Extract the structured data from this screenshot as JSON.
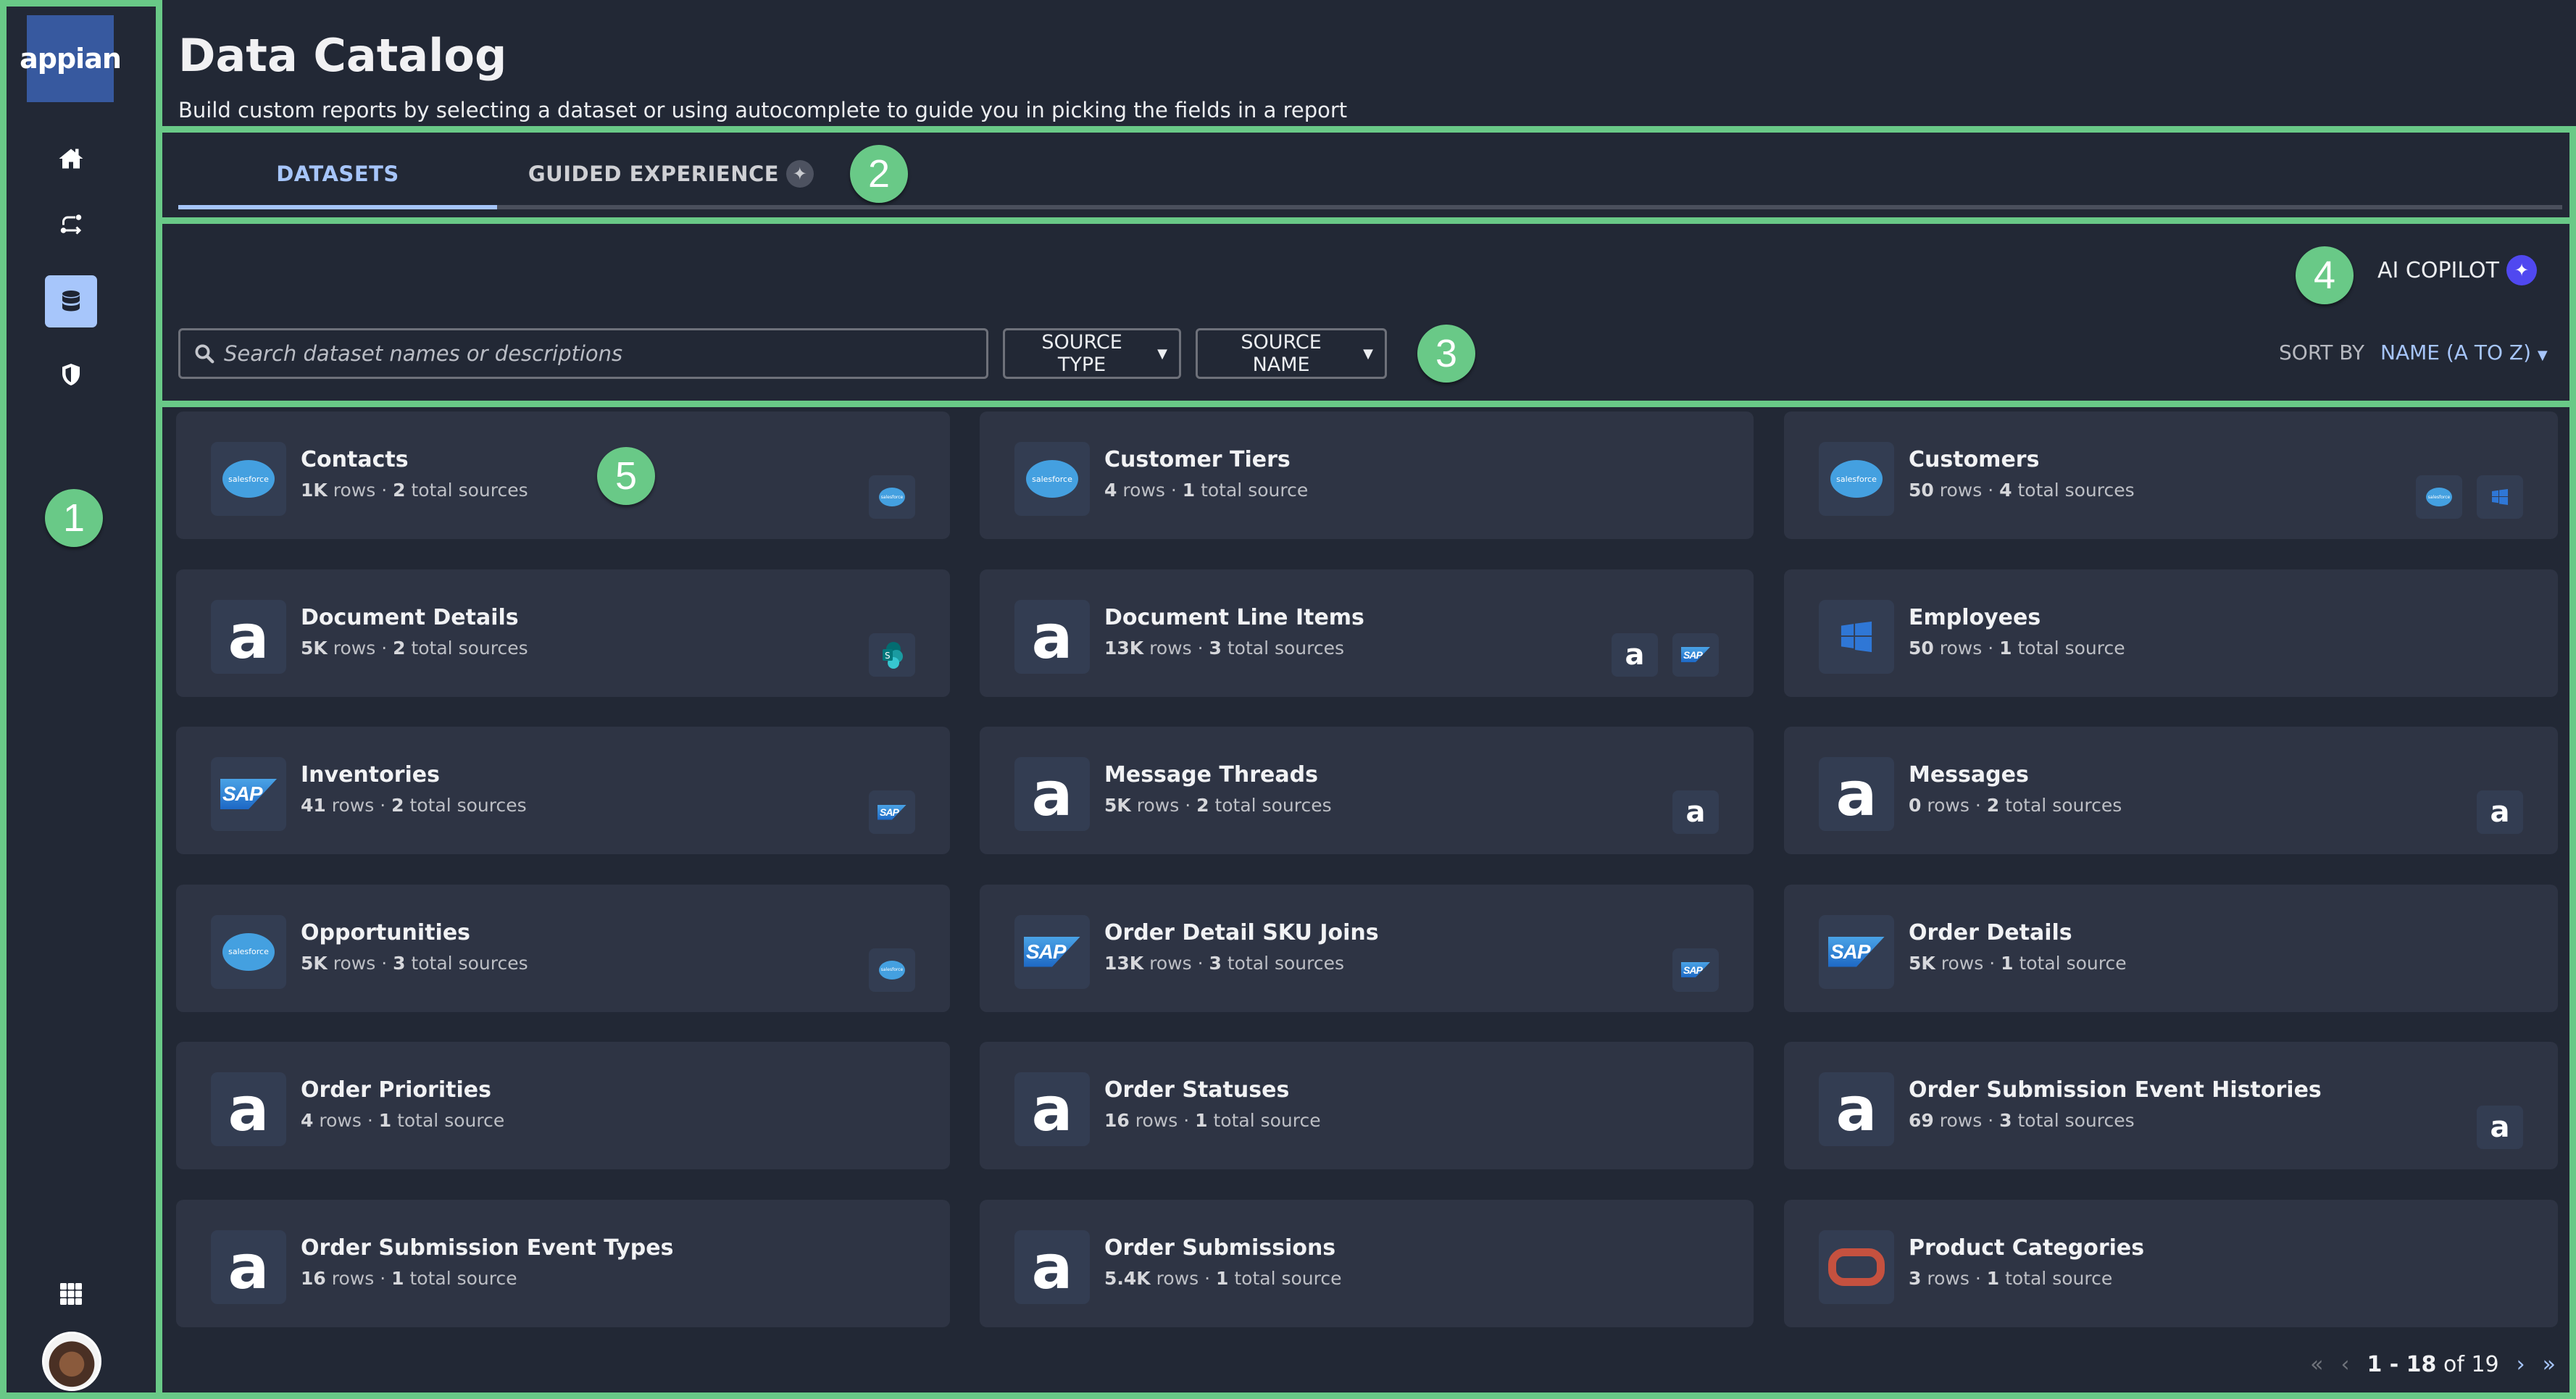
{
  "app": {
    "logo_text": "appian"
  },
  "sidebar": {
    "items": [
      {
        "name": "home",
        "icon": "home-icon",
        "active": false
      },
      {
        "name": "process",
        "icon": "process-flow-icon",
        "active": false
      },
      {
        "name": "data",
        "icon": "database-icon",
        "active": true
      },
      {
        "name": "security",
        "icon": "shield-icon",
        "active": false
      }
    ],
    "apps_icon": "grid-icon",
    "avatar": "user-avatar"
  },
  "header": {
    "title": "Data Catalog",
    "subtitle": "Build custom reports by selecting a dataset or using autocomplete to guide you in picking the fields in a report"
  },
  "tabs": [
    {
      "label": "DATASETS",
      "active": true
    },
    {
      "label": "GUIDED EXPERIENCE",
      "active": false,
      "icon": "sparkle-icon"
    }
  ],
  "toolbar": {
    "copilot_label": "AI COPILOT",
    "search_placeholder": "Search dataset names or descriptions",
    "search_value": "",
    "filters": [
      {
        "label": "SOURCE TYPE"
      },
      {
        "label": "SOURCE NAME"
      }
    ],
    "sort_label": "SORT BY",
    "sort_value": "NAME (A TO Z)"
  },
  "datasets": [
    {
      "name": "Contacts",
      "rows": "1K",
      "sources": "2",
      "sources_label": "total sources",
      "icon": "salesforce",
      "source_icons": [
        "salesforce"
      ]
    },
    {
      "name": "Customer Tiers",
      "rows": "4",
      "sources": "1",
      "sources_label": "total source",
      "icon": "salesforce",
      "source_icons": []
    },
    {
      "name": "Customers",
      "rows": "50",
      "sources": "4",
      "sources_label": "total sources",
      "icon": "salesforce",
      "source_icons": [
        "salesforce",
        "windows"
      ]
    },
    {
      "name": "Document Details",
      "rows": "5K",
      "sources": "2",
      "sources_label": "total sources",
      "icon": "appian",
      "source_icons": [
        "sharepoint"
      ]
    },
    {
      "name": "Document Line Items",
      "rows": "13K",
      "sources": "3",
      "sources_label": "total sources",
      "icon": "appian",
      "source_icons": [
        "appian",
        "sap"
      ]
    },
    {
      "name": "Employees",
      "rows": "50",
      "sources": "1",
      "sources_label": "total source",
      "icon": "windows",
      "source_icons": []
    },
    {
      "name": "Inventories",
      "rows": "41",
      "sources": "2",
      "sources_label": "total sources",
      "icon": "sap",
      "source_icons": [
        "sap"
      ]
    },
    {
      "name": "Message Threads",
      "rows": "5K",
      "sources": "2",
      "sources_label": "total sources",
      "icon": "appian",
      "source_icons": [
        "appian"
      ]
    },
    {
      "name": "Messages",
      "rows": "0",
      "sources": "2",
      "sources_label": "total sources",
      "icon": "appian",
      "source_icons": [
        "appian"
      ]
    },
    {
      "name": "Opportunities",
      "rows": "5K",
      "sources": "3",
      "sources_label": "total sources",
      "icon": "salesforce",
      "source_icons": [
        "salesforce"
      ]
    },
    {
      "name": "Order Detail SKU Joins",
      "rows": "13K",
      "sources": "3",
      "sources_label": "total sources",
      "icon": "sap",
      "source_icons": [
        "sap"
      ]
    },
    {
      "name": "Order Details",
      "rows": "5K",
      "sources": "1",
      "sources_label": "total source",
      "icon": "sap",
      "source_icons": []
    },
    {
      "name": "Order Priorities",
      "rows": "4",
      "sources": "1",
      "sources_label": "total source",
      "icon": "appian",
      "source_icons": []
    },
    {
      "name": "Order Statuses",
      "rows": "16",
      "sources": "1",
      "sources_label": "total source",
      "icon": "appian",
      "source_icons": []
    },
    {
      "name": "Order Submission Event Histories",
      "rows": "69",
      "sources": "3",
      "sources_label": "total sources",
      "icon": "appian",
      "source_icons": [
        "appian"
      ]
    },
    {
      "name": "Order Submission Event Types",
      "rows": "16",
      "sources": "1",
      "sources_label": "total source",
      "icon": "appian",
      "source_icons": []
    },
    {
      "name": "Order Submissions",
      "rows": "5.4K",
      "sources": "1",
      "sources_label": "total source",
      "icon": "appian",
      "source_icons": []
    },
    {
      "name": "Product Categories",
      "rows": "3",
      "sources": "1",
      "sources_label": "total source",
      "icon": "oracle",
      "source_icons": []
    }
  ],
  "meta_words": {
    "rows": "rows",
    "separator": "·"
  },
  "pagination": {
    "range": "1 - 18",
    "of_label": "of",
    "total": "19"
  },
  "annotations": [
    "1",
    "2",
    "3",
    "4",
    "5"
  ],
  "colors": {
    "accent": "#a6c5fa",
    "annotation": "#69c987",
    "copilot": "#5048f0",
    "card_bg": "#2e3444",
    "page_bg": "#222835"
  }
}
